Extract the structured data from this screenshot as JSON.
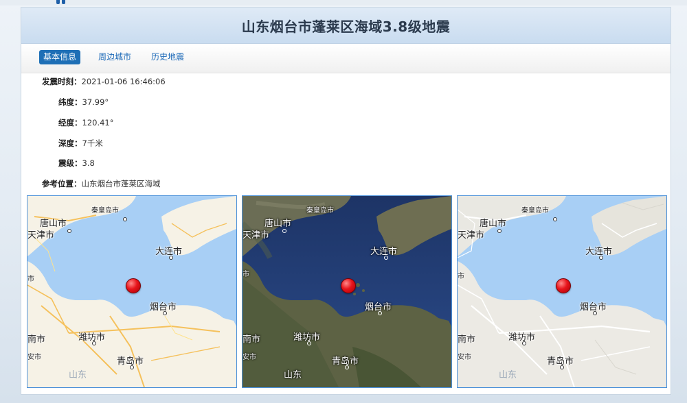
{
  "page": {
    "title": "山东烟台市蓬莱区海域3.8级地震"
  },
  "tabs": [
    {
      "label": "基本信息",
      "active": true
    },
    {
      "label": "周边城市",
      "active": false
    },
    {
      "label": "历史地震",
      "active": false
    }
  ],
  "info": {
    "time": {
      "label": "发震时刻：",
      "value": "2021-01-06 16:46:06"
    },
    "lat": {
      "label": "纬度：",
      "value": "37.99°"
    },
    "lon": {
      "label": "经度：",
      "value": "120.41°"
    },
    "depth": {
      "label": "深度：",
      "value": "7千米"
    },
    "mag": {
      "label": "震级：",
      "value": "3.8"
    },
    "ref": {
      "label": "参考位置：",
      "value": "山东烟台市蓬莱区海域"
    }
  },
  "maps": {
    "cities": {
      "qinhuangdao": "秦皇岛市",
      "tangshan": "唐山市",
      "tianjin": "天津市",
      "dalian": "大连市",
      "yantai": "烟台市",
      "weifang": "潍坊市",
      "jinan": "南市",
      "taian": "安市",
      "qingdao": "青岛市",
      "shandong": "山东",
      "cut_left": "市"
    },
    "types": [
      "road",
      "satellite",
      "gray"
    ],
    "colors": {
      "sea": "#a8cff5",
      "road_land": "#f6f2e6",
      "sat_sea": "#24427a",
      "sat_land": "#5a6040",
      "gray_land": "#eceae4",
      "quake": "#e8141b",
      "border": "#4a90d9"
    }
  }
}
